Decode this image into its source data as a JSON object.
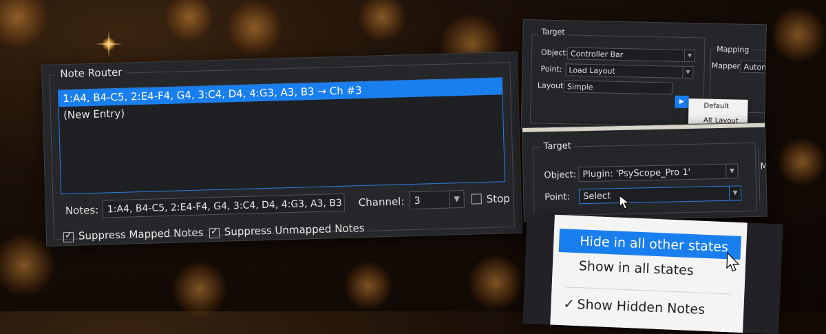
{
  "note_router": {
    "title": "Note Router",
    "entries": [
      "1:A4, B4-C5, 2:E4-F4, G4, 3:C4, D4, 4:G3, A3, B3 → Ch #3",
      "(New Entry)"
    ],
    "notes_label": "Notes:",
    "notes_value": "1:A4, B4-C5, 2:E4-F4, G4, 3:C4, D4, 4:G3, A3, B3",
    "channel_label": "Channel:",
    "channel_value": "3",
    "stop_label": "Stop",
    "stop_checked": false,
    "suppress_mapped_label": "Suppress Mapped Notes",
    "suppress_mapped_checked": true,
    "suppress_unmapped_label": "Suppress Unmapped Notes",
    "suppress_unmapped_checked": true
  },
  "target_panel_1": {
    "title": "Target",
    "object_label": "Object:",
    "object_value": "Controller Bar",
    "point_label": "Point:",
    "point_value": "Load Layout",
    "layout_label": "Layout:",
    "layout_value": "Simple",
    "mapping_title": "Mapping",
    "mapper_label": "Mapper:",
    "mapper_value": "Autom",
    "menu_items": [
      "Default",
      "Alt Layout"
    ]
  },
  "target_panel_2": {
    "title": "Target",
    "object_label": "Object:",
    "object_value": "Plugin: 'PsyScope_Pro 1'",
    "point_label": "Point:",
    "point_value": "Select",
    "side_label": "M"
  },
  "context_menu": {
    "items": [
      "Hide in all other states",
      "Show in all states",
      "Show Hidden Notes"
    ],
    "highlighted_index": 0
  },
  "colors": {
    "accent": "#1a7fee",
    "panel_bg": "#26272a",
    "background": "#1c1008"
  }
}
